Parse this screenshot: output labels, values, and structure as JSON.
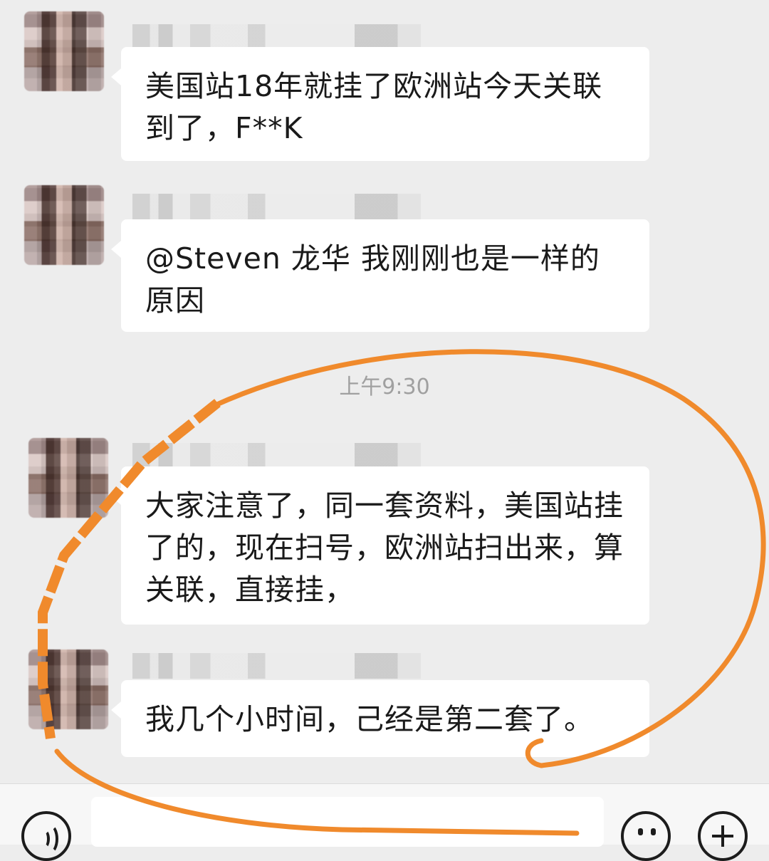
{
  "messages": [
    {
      "text": "美国站18年就挂了欧洲站今天关联到了，F**K"
    },
    {
      "text": "@Steven  龙华  我刚刚也是一样的原因"
    },
    {
      "text": "大家注意了，同一套资料，美国站挂了的，现在扫号，欧洲站扫出来，算关联，直接挂，"
    },
    {
      "text": "我几个小时间，己经是第二套了。"
    }
  ],
  "timestamp": "上午9:30",
  "input_bar": {
    "voice_icon": "voice-icon",
    "emoji_icon": "emoji-icon",
    "plus_icon": "plus-icon"
  },
  "colors": {
    "background": "#ededed",
    "bubble": "#ffffff",
    "annotation": "#f08a2c",
    "timestamp": "#a0a0a0"
  }
}
